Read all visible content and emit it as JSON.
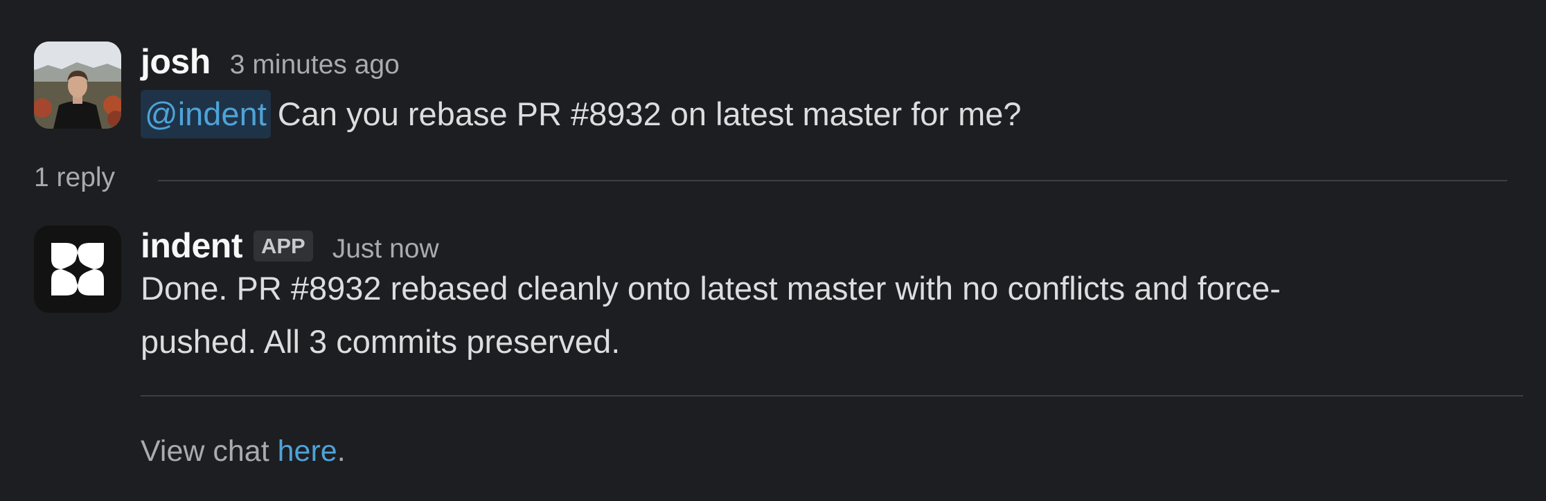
{
  "messages": [
    {
      "author": "josh",
      "timestamp": "3 minutes ago",
      "avatar_icon": "user-photo",
      "mention": "@indent",
      "text": "Can you rebase PR #8932 on latest master for me?"
    },
    {
      "author": "indent",
      "badge": "APP",
      "timestamp": "Just now",
      "avatar_icon": "indent-logo-icon",
      "text_line1": "Done. PR #8932 rebased cleanly onto latest master with no conflicts and force-",
      "text_line2": "pushed. All 3 commits preserved.",
      "footer_prefix": "View chat ",
      "footer_link": "here",
      "footer_suffix": "."
    }
  ],
  "thread": {
    "reply_count": "1 reply"
  },
  "colors": {
    "background": "#1d1e21",
    "link": "#4ea3d8",
    "mention_bg": "#1f3348"
  }
}
